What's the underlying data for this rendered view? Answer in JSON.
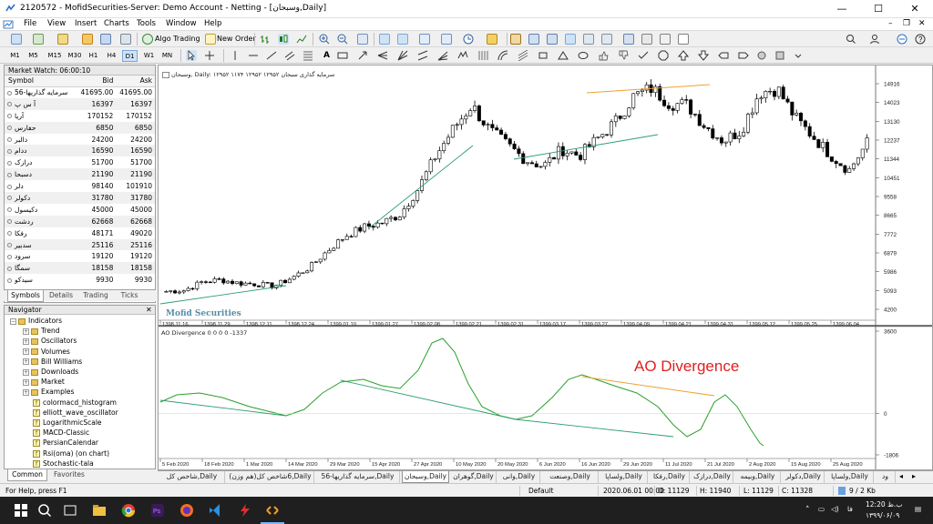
{
  "window": {
    "title": "2120572 - MofidSecurities-Server: Demo Account - Netting - [وسبحان,Daily]",
    "minimize_glyph": "—",
    "maximize_glyph": "☐",
    "close_glyph": "✕"
  },
  "menu": [
    "File",
    "View",
    "Insert",
    "Charts",
    "Tools",
    "Window",
    "Help"
  ],
  "toolbar": {
    "algo_trading": "Algo Trading",
    "new_order": "New Order",
    "timeframes": [
      "M1",
      "M5",
      "M15",
      "M30",
      "H1",
      "H4",
      "D1",
      "W1",
      "MN"
    ],
    "active_timeframe": "D1"
  },
  "market_watch": {
    "title": "Market Watch: 06:00:10",
    "columns": [
      "Symbol",
      "Bid",
      "Ask"
    ],
    "rows": [
      {
        "symbol": "سرمایه گذاریها-56",
        "bid": "41695.00",
        "ask": "41695.00"
      },
      {
        "symbol": "آ س پ",
        "bid": "16397",
        "ask": "16397"
      },
      {
        "symbol": "آريا",
        "bid": "170152",
        "ask": "170152"
      },
      {
        "symbol": "حفارس",
        "bid": "6850",
        "ask": "6850"
      },
      {
        "symbol": "دالبر",
        "bid": "24200",
        "ask": "24200"
      },
      {
        "symbol": "ددام",
        "bid": "16590",
        "ask": "16590"
      },
      {
        "symbol": "درازک",
        "bid": "51700",
        "ask": "51700"
      },
      {
        "symbol": "دسبحا",
        "bid": "21190",
        "ask": "21190"
      },
      {
        "symbol": "دلر",
        "bid": "98140",
        "ask": "101910"
      },
      {
        "symbol": "دکولر",
        "bid": "31780",
        "ask": "31780"
      },
      {
        "symbol": "دکیسول",
        "bid": "45000",
        "ask": "45000"
      },
      {
        "symbol": "ردشت",
        "bid": "62668",
        "ask": "62668"
      },
      {
        "symbol": "رفکا",
        "bid": "48171",
        "ask": "49020"
      },
      {
        "symbol": "سدبير",
        "bid": "25116",
        "ask": "25116"
      },
      {
        "symbol": "سرود",
        "bid": "19120",
        "ask": "19120"
      },
      {
        "symbol": "سمگا",
        "bid": "18158",
        "ask": "18158"
      },
      {
        "symbol": "سيدکو",
        "bid": "9930",
        "ask": "9930"
      }
    ],
    "tabs": [
      "Symbols",
      "Details",
      "Trading",
      "Ticks"
    ]
  },
  "navigator": {
    "title": "Navigator",
    "items": [
      {
        "label": "Indicators",
        "kind": "folder",
        "level": 0,
        "expander": "−"
      },
      {
        "label": "Trend",
        "kind": "folder",
        "level": 1,
        "expander": "+"
      },
      {
        "label": "Oscillators",
        "kind": "folder",
        "level": 1,
        "expander": "+"
      },
      {
        "label": "Volumes",
        "kind": "folder",
        "level": 1,
        "expander": "+"
      },
      {
        "label": "Bill Williams",
        "kind": "folder",
        "level": 1,
        "expander": "+"
      },
      {
        "label": "Downloads",
        "kind": "folder",
        "level": 1,
        "expander": "+"
      },
      {
        "label": "Market",
        "kind": "folder",
        "level": 1,
        "expander": "+"
      },
      {
        "label": "Examples",
        "kind": "folder",
        "level": 1,
        "expander": "+"
      },
      {
        "label": "colormacd_histogram",
        "kind": "indicator",
        "level": 1
      },
      {
        "label": "elliott_wave_oscillator",
        "kind": "indicator",
        "level": 1
      },
      {
        "label": "LogarithmicScale",
        "kind": "indicator",
        "level": 1
      },
      {
        "label": "MACD-Classic",
        "kind": "indicator",
        "level": 1
      },
      {
        "label": "PersianCalendar",
        "kind": "indicator",
        "level": 1
      },
      {
        "label": "Rsi(oma) (on chart)",
        "kind": "indicator",
        "level": 1
      },
      {
        "label": "Stochastic-tala",
        "kind": "indicator",
        "level": 1
      }
    ],
    "tabs": [
      "Common",
      "Favorites"
    ]
  },
  "chart": {
    "header": "وسبحان, Daily: ۱۲۹۵۲ ۱۱۷۴ ۱۲۹۵۲ ۱۲۹۵۲ سرمایه گذاری سبحان",
    "watermark": "Mofid Securities",
    "indicator_label": "AO Divergence 0 0 0 0 -1337",
    "annotation": "AO Divergence",
    "colors": {
      "bull": "#ffffff",
      "bear": "#000000",
      "trend_green": "#2e9e6e",
      "trend_orange": "#f0a030",
      "ao": "#2aa02a",
      "annotation_red": "#e02020"
    }
  },
  "chart_data": [
    {
      "type": "candlestick",
      "title": "وسبحان, Daily",
      "y_ticks": [
        "14916",
        "14023",
        "13130",
        "12237",
        "11344",
        "10451",
        "9558",
        "8665",
        "7772",
        "6879",
        "5986",
        "5093",
        "4200"
      ],
      "persian_date_ticks": [
        "1398.11.16",
        "1398.11.29",
        "1398.12.11",
        "1398.12.24",
        "1399.01.10",
        "1399.01.27",
        "1399.02.08",
        "1399.02.21",
        "1399.02.31",
        "1399.03.17",
        "1399.03.27",
        "1399.04.09",
        "1399.04.21",
        "1399.04.31",
        "1399.05.12",
        "1399.05.25",
        "1399.06.04"
      ],
      "ylim": [
        4200,
        14916
      ],
      "approx_close_path": [
        5050,
        5100,
        5500,
        5600,
        5450,
        5400,
        5300,
        5700,
        6200,
        7000,
        7700,
        8100,
        8300,
        8700,
        9900,
        11500,
        12800,
        13900,
        12700,
        12000,
        11300,
        11000,
        11800,
        11500,
        12300,
        13100,
        14300,
        14700,
        14000,
        13900,
        12900,
        12200,
        12700,
        14500,
        14700,
        13300,
        12400,
        11500,
        10800,
        12100
      ]
    },
    {
      "type": "line",
      "title": "AO Divergence",
      "y_ticks": [
        "3600",
        "0",
        "-1806"
      ],
      "date_ticks": [
        "5 Feb 2020",
        "18 Feb 2020",
        "1 Mar 2020",
        "14 Mar 2020",
        "29 Mar 2020",
        "15 Apr 2020",
        "27 Apr 2020",
        "10 May 2020",
        "20 May 2020",
        "6 Jun 2020",
        "16 Jun 2020",
        "29 Jun 2020",
        "11 Jul 2020",
        "21 Jul 2020",
        "2 Aug 2020",
        "15 Aug 2020",
        "25 Aug 2020"
      ],
      "ylim": [
        -1806,
        3600
      ]
    }
  ],
  "chart_tabs": [
    "شاخص کل,Daily",
    "(هم وزن)6شاخص کل,Daily",
    "سرمایه گذاریها-56,Daily",
    "وسبحان,Daily",
    "گوهران,Daily",
    "وانی,Daily",
    "وصنعت,Daily",
    "ولساپا,Daily",
    "رفکا,Daily",
    "درازک,Daily",
    "وبیمه,Daily",
    "دکولر,Daily",
    "ولساپا,Daily",
    "ود"
  ],
  "active_chart_tab": "وسبحان,Daily",
  "status": {
    "help": "For Help, press F1",
    "profile": "Default",
    "datetime": "2020.06.01 00:00",
    "open": "O: 11129",
    "high": "H: 11940",
    "low": "L: 11129",
    "close": "C: 11328",
    "traffic": "9 / 2 Kb"
  },
  "taskbar": {
    "time": "12:20 ب.ظ",
    "date": "۱۳۹۹/۰۶/۰۹",
    "lang": "فا"
  }
}
